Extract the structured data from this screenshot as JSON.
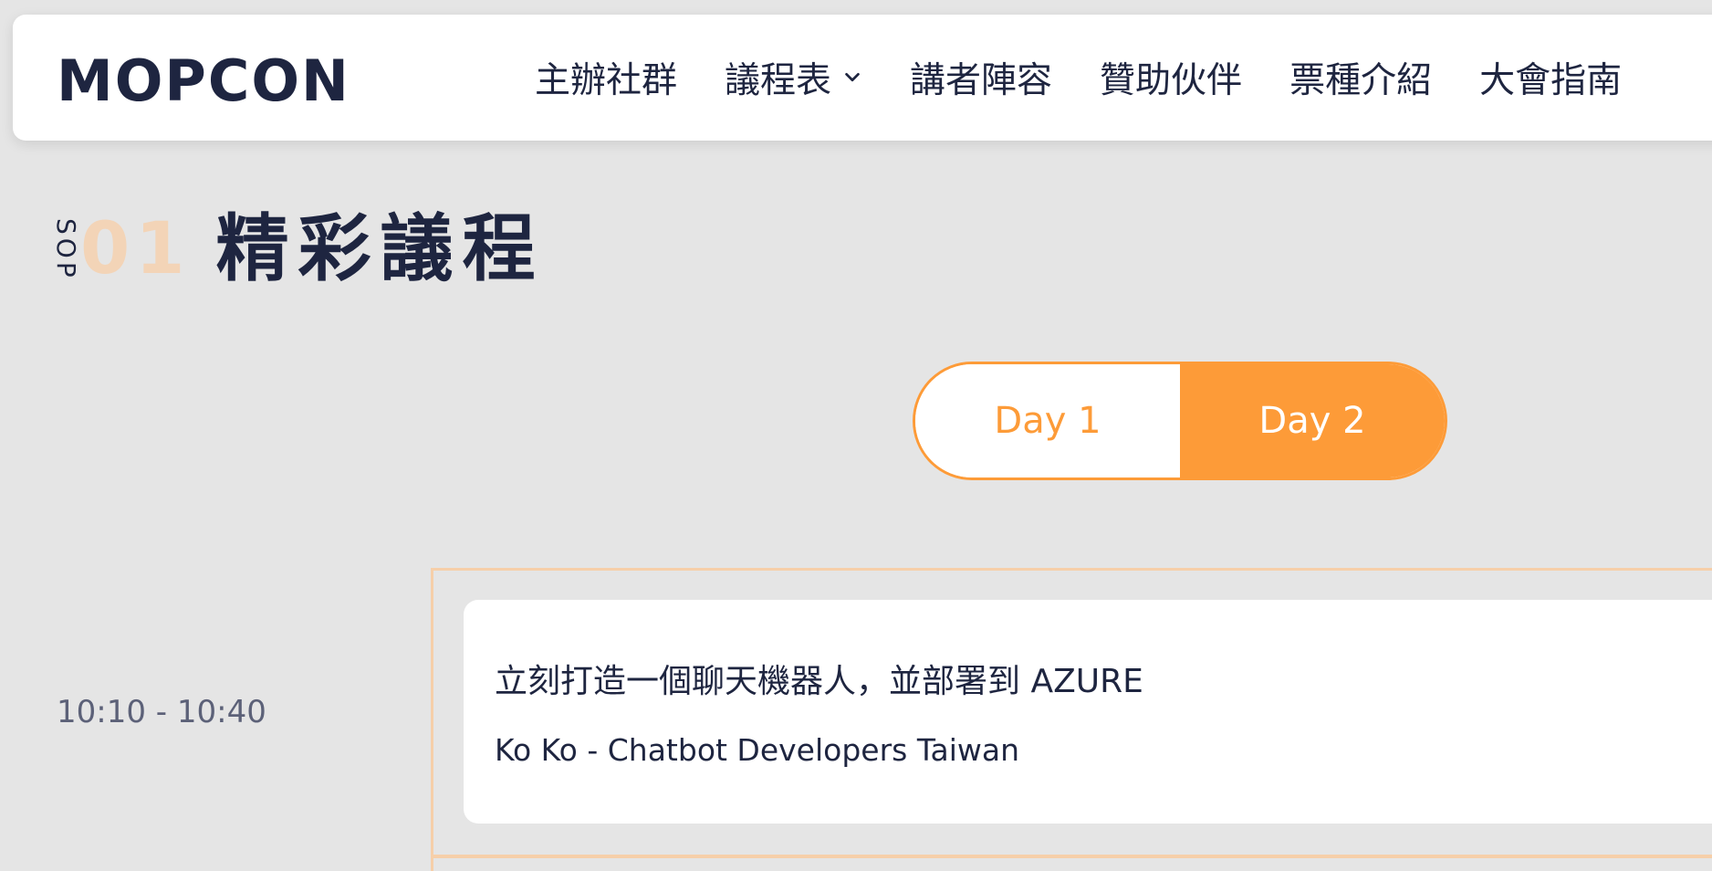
{
  "header": {
    "logo_text": "MOPCON",
    "nav": [
      {
        "label": "主辦社群",
        "has_dropdown": false
      },
      {
        "label": "議程表",
        "has_dropdown": true
      },
      {
        "label": "講者陣容",
        "has_dropdown": false
      },
      {
        "label": "贊助伙伴",
        "has_dropdown": false
      },
      {
        "label": "票種介紹",
        "has_dropdown": false
      },
      {
        "label": "大會指南",
        "has_dropdown": false
      }
    ]
  },
  "section": {
    "prefix": "SOP",
    "number": "01",
    "title": "精彩議程"
  },
  "day_toggle": {
    "day1": "Day 1",
    "day2": "Day 2",
    "selected": "Day 2"
  },
  "sessions": [
    {
      "time": "10:10 - 10:40",
      "title": "立刻打造一個聊天機器人，並部署到 AZURE",
      "speaker": "Ko Ko - Chatbot Developers Taiwan"
    }
  ],
  "colors": {
    "accent": "#fd9b38",
    "navy": "#1e2540",
    "number_peach": "#f3d4b7",
    "frame_border": "#f6cfa9",
    "background": "#e5e5e5"
  }
}
